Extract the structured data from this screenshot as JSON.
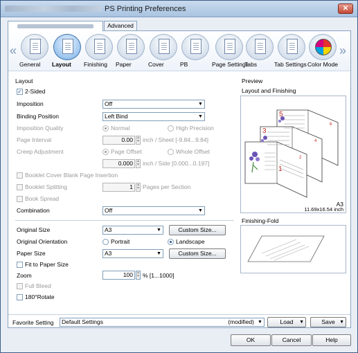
{
  "window": {
    "title": "PS Printing Preferences",
    "close_label": "✕"
  },
  "tabs": [
    {
      "label": ""
    },
    {
      "label": "Advanced"
    }
  ],
  "toolbar": {
    "items": [
      {
        "label": "General",
        "icon": "general-icon"
      },
      {
        "label": "Layout",
        "icon": "layout-icon"
      },
      {
        "label": "Finishing",
        "icon": "finishing-icon"
      },
      {
        "label": "Paper",
        "icon": "paper-icon"
      },
      {
        "label": "Cover",
        "icon": "cover-icon"
      },
      {
        "label": "PB",
        "icon": "pb-icon"
      },
      {
        "label": "Page Settings",
        "icon": "page-settings-icon"
      },
      {
        "label": "Tabs",
        "icon": "tabs-icon"
      },
      {
        "label": "Tab Settings",
        "icon": "tab-settings-icon"
      },
      {
        "label": "Color Mode",
        "icon": "color-mode-icon"
      }
    ],
    "left_arrow": "«",
    "right_arrow": "»"
  },
  "layout": {
    "section_title": "Layout",
    "two_sided_label": "2-Sided",
    "imposition_label": "Imposition",
    "imposition_value": "Off",
    "binding_label": "Binding Position",
    "binding_value": "Left Bind",
    "imposition_quality_label": "Imposition Quality",
    "quality_normal": "Normal",
    "quality_high": "High Precision",
    "page_interval_label": "Page Interval",
    "page_interval_value": "0.00",
    "page_interval_unit": "inch / Sheet [-9.84...9.84]",
    "creep_label": "Creep Adjustment",
    "creep_page_offset": "Page Offset",
    "creep_whole_offset": "Whole Offset",
    "creep_value": "0.000",
    "creep_unit": "inch / Side [0.000...0.197]",
    "booklet_blank_label": "Booklet Cover Blank Page Insertion",
    "booklet_split_label": "Booklet Splitting",
    "booklet_split_value": "1",
    "booklet_split_unit": "Pages per Section",
    "book_spread_label": "Book Spread",
    "combination_label": "Combination",
    "combination_value": "Off"
  },
  "paper": {
    "original_size_label": "Original Size",
    "original_size_value": "A3",
    "custom_size_1": "Custom Size...",
    "orientation_label": "Original Orientation",
    "orientation_portrait": "Portrait",
    "orientation_landscape": "Landscape",
    "paper_size_label": "Paper Size",
    "paper_size_value": "A3",
    "custom_size_2": "Custom Size...",
    "fit_label": "Fit to Paper Size",
    "zoom_label": "Zoom",
    "zoom_value": "100",
    "zoom_unit": "% [1...1000]",
    "full_bleed_label": "Full Bleed",
    "rotate_label": "180°Rotate"
  },
  "preview": {
    "section_title": "Preview",
    "layout_title": "Layout and Finishing",
    "paper_name": "A3",
    "paper_dims": "11.69x16.54 inch",
    "finishing_title": "Finishing-Fold",
    "page_numbers": [
      "5",
      "6",
      "3",
      "4",
      "1",
      "2"
    ]
  },
  "favorite": {
    "label": "Favorite Setting",
    "value": "Default Settings",
    "modified": "(modified)",
    "load_label": "Load",
    "save_label": "Save"
  },
  "dialog": {
    "ok_label": "OK",
    "cancel_label": "Cancel",
    "help_label": "Help"
  },
  "colors": {
    "accent": "#1d4e8f",
    "page_number": "#c2271f"
  }
}
